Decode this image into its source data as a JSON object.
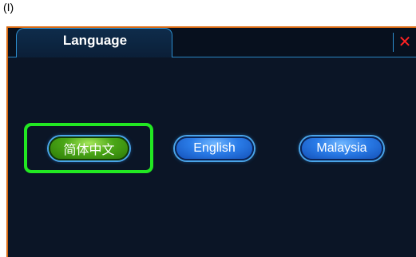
{
  "caption": "(I)",
  "window": {
    "tab_title": "Language",
    "close_glyph": "✕"
  },
  "languages": [
    {
      "label": "简体中文",
      "selected": true
    },
    {
      "label": "English",
      "selected": false
    },
    {
      "label": "Malaysia",
      "selected": false
    }
  ],
  "colors": {
    "window_border": "#d96a13",
    "background": "#0b1526",
    "accent_blue": "#2d8fd0",
    "selected_highlight": "#22e822",
    "close_red": "#ff2222"
  },
  "icons": {
    "close": "close-icon"
  }
}
